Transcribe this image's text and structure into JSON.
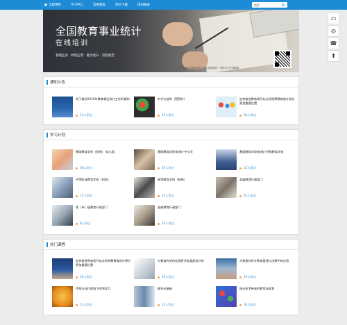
{
  "header": {
    "nav": [
      {
        "label": "全部课程",
        "icon": "home-icon"
      },
      {
        "label": "学习中心"
      },
      {
        "label": "案例图鉴"
      },
      {
        "label": "资料下载"
      },
      {
        "label": "培训报名"
      }
    ],
    "search_placeholder": "搜索"
  },
  "banner": {
    "title": "全国教育事业统计",
    "subtitle": "在线培训",
    "tags": "基础业务 · 特色应用 · 能力提升 · 流程规范",
    "note": "本平台由全国各地统计人员共同维护，仅供学习交流使用"
  },
  "side_tools": [
    "chat-icon",
    "wechat-icon",
    "phone-icon",
    "back-to-top-icon"
  ],
  "colors": {
    "accent": "#1e8bd6",
    "meta": "#2a8bd6",
    "user_dot": "#f2a24b"
  },
  "sections": {
    "notice": {
      "title": "通知公告",
      "items": [
        {
          "title": "关于做好2018年教育事业统计工作的通知",
          "meta": "13人学过"
        },
        {
          "title": "时代与使命（暨预付）",
          "meta": "11人学过"
        },
        {
          "title": "加快推进教育现代化必须统筹教育统计原在更加重要位置",
          "meta": "30人学过"
        }
      ]
    },
    "plan": {
      "title": "学习计划",
      "items": [
        {
          "title": "基础教育学校（机构）-幼儿园",
          "meta": "38人学过"
        },
        {
          "title": "基础教育学校(机构)-中小学",
          "meta": "20人学过"
        },
        {
          "title": "基础教育学校(机构)-特殊教育学校",
          "meta": "15人学过"
        },
        {
          "title": "中等职业教育学校（机构）",
          "meta": "15人学过"
        },
        {
          "title": "高等教育学校（机构）",
          "meta": "27人学过"
        },
        {
          "title": "县级教育行政部门",
          "meta": "25人学过"
        },
        {
          "title": "地（市）级教育行政部门",
          "meta": "8人学过"
        },
        {
          "title": "省级教育行政部门",
          "meta": "23人学过"
        }
      ]
    },
    "hot": {
      "title": "热门课程",
      "items": [
        {
          "title": "加快推进教育现代化必须统筹教育统计原在更加重要位置",
          "meta": "30人学过"
        },
        {
          "title": "与教育有关的宏观经济发展趋势分析",
          "meta": "20人学过"
        },
        {
          "title": "大数据分析在教育管理与决策中的应用",
          "meta": "24人学过"
        },
        {
          "title": "传统与现代视角下的领导力",
          "meta": "13人学过"
        },
        {
          "title": "概率论基础",
          "meta": "12人学过"
        },
        {
          "title": "移动技术带来的教育业规划",
          "meta": "30人学过"
        }
      ]
    }
  }
}
